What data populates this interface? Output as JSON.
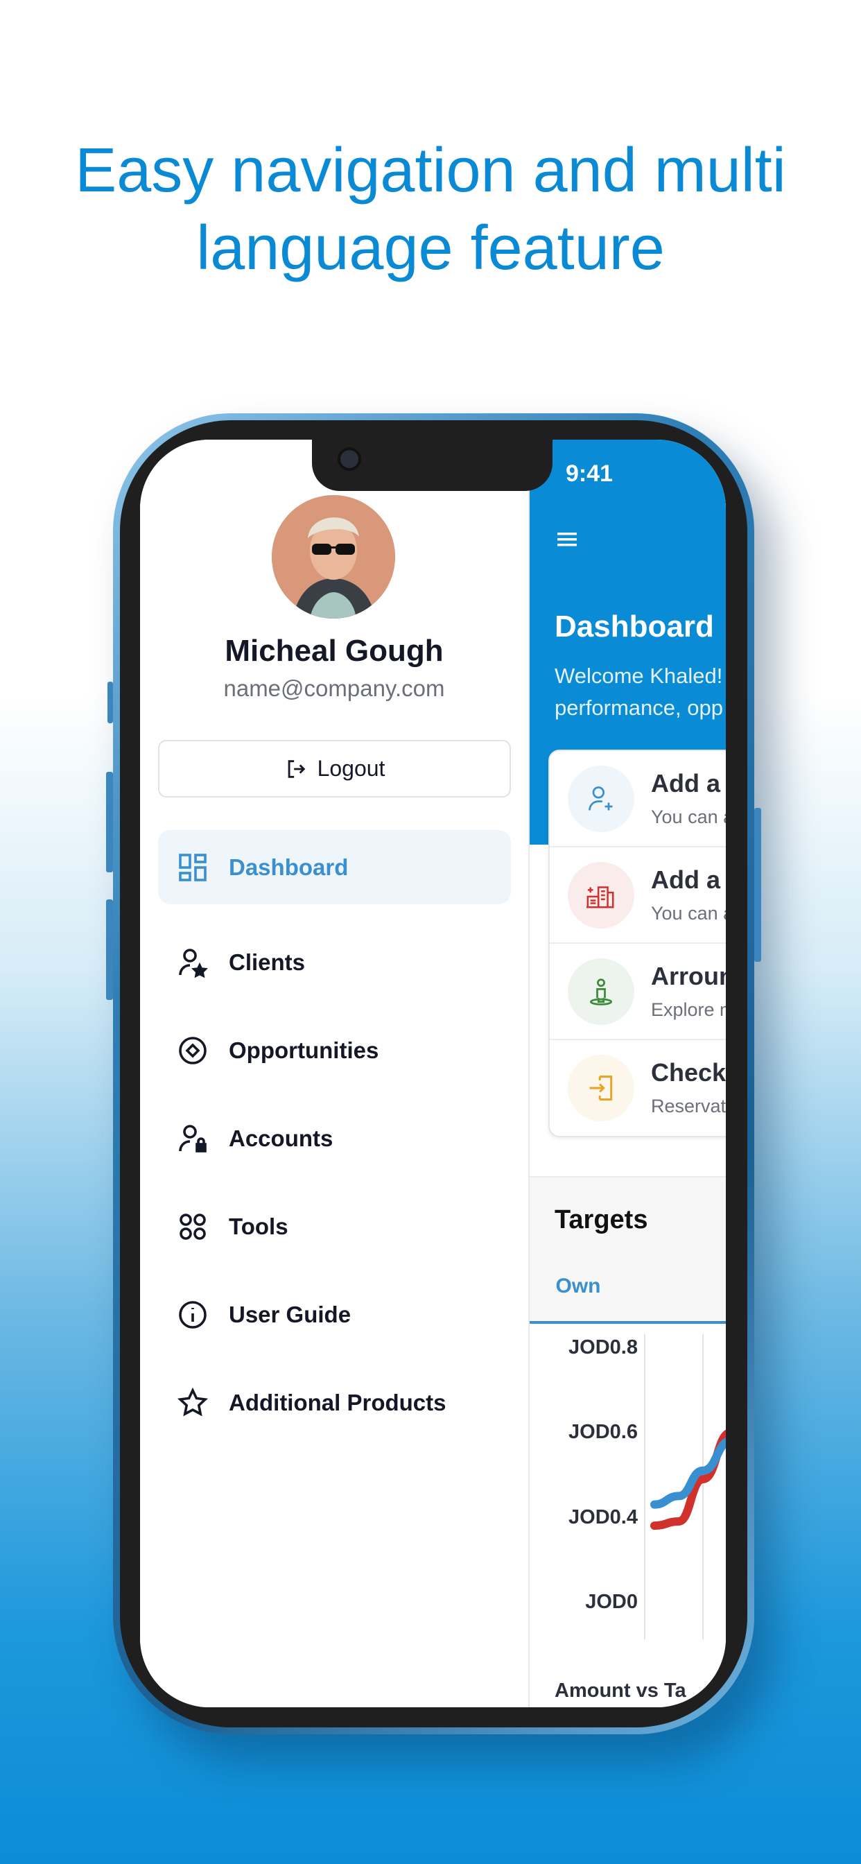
{
  "headline": {
    "line1": "Easy navigation and multi",
    "line2": "language feature"
  },
  "status_bar": {
    "time": "9:41"
  },
  "drawer": {
    "user_name": "Micheal Gough",
    "user_email": "name@company.com",
    "logout_label": "Logout",
    "items": [
      {
        "label": "Dashboard",
        "icon": "dashboard-icon",
        "active": true
      },
      {
        "label": "Clients",
        "icon": "user-star-icon"
      },
      {
        "label": "Opportunities",
        "icon": "target-diamond-icon"
      },
      {
        "label": "Accounts",
        "icon": "user-lock-icon"
      },
      {
        "label": "Tools",
        "icon": "four-circles-icon"
      },
      {
        "label": "User Guide",
        "icon": "info-icon"
      },
      {
        "label": "Additional Products",
        "icon": "star-icon"
      }
    ]
  },
  "dashboard": {
    "title": "Dashboard",
    "welcome_line1": "Welcome Khaled!",
    "welcome_line2": "performance, opp",
    "actions": [
      {
        "title": "Add a p",
        "subtitle": "You can a",
        "icon": "user-plus-icon",
        "color": "#3a8fd0",
        "bg": "#eef6fc"
      },
      {
        "title": "Add a B",
        "subtitle": "You can a",
        "icon": "buildings-icon",
        "color": "#d0312d",
        "bg": "#fbecec"
      },
      {
        "title": "Arroun",
        "subtitle": "Explore m",
        "icon": "location-person-icon",
        "color": "#3d8a3d",
        "bg": "#edf4ee"
      },
      {
        "title": "Check",
        "subtitle": "Reservati",
        "icon": "sign-in-icon",
        "color": "#e8a321",
        "bg": "#fdf6ea"
      }
    ],
    "targets": {
      "title": "Targets",
      "tab": "Own"
    }
  },
  "chart_data": {
    "type": "line",
    "title": "Amount vs Ta",
    "y_tick_labels": [
      "JOD0.8",
      "JOD0.6",
      "JOD0.4",
      "JOD0"
    ],
    "series": [
      {
        "color": "#3a8fd0",
        "values": [
          0.44,
          0.46,
          0.52,
          0.59
        ]
      },
      {
        "color": "#d0312d",
        "values": [
          0.38,
          0.4,
          0.5,
          0.61
        ]
      }
    ]
  }
}
